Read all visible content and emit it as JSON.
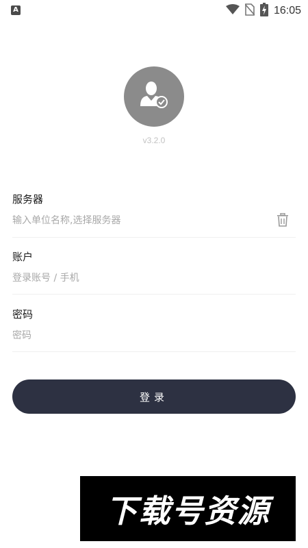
{
  "status_bar": {
    "app_icon_letter": "A",
    "time": "16:05",
    "icons": [
      "wifi-icon",
      "no-sim-icon",
      "battery-charging-icon"
    ]
  },
  "avatar": {
    "icon": "user-check-icon",
    "version": "v3.2.0"
  },
  "form": {
    "server": {
      "label": "服务器",
      "placeholder": "输入单位名称,选择服务器",
      "value": "",
      "clear_icon": "trash-icon"
    },
    "account": {
      "label": "账户",
      "placeholder": "登录账号 / 手机",
      "value": ""
    },
    "password": {
      "label": "密码",
      "placeholder": "密码",
      "value": ""
    }
  },
  "login_button": {
    "label": "登录"
  },
  "watermark": {
    "text": "下载号资源"
  },
  "colors": {
    "button_bg": "#2d3142",
    "avatar_bg": "#8b8b8b",
    "placeholder": "#a8a8a8",
    "divider": "#efefef"
  }
}
